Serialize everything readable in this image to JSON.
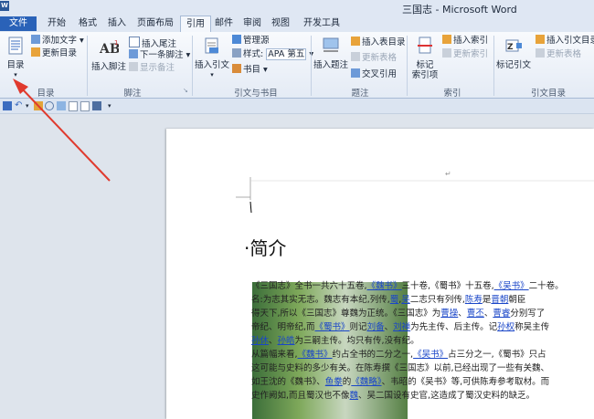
{
  "window": {
    "title": "三国志 - Microsoft Word",
    "app_letter": "W"
  },
  "tabs": [
    {
      "label": "文件",
      "name": "tab-file"
    },
    {
      "label": "开始",
      "name": "tab-home"
    },
    {
      "label": "格式",
      "name": "tab-format"
    },
    {
      "label": "插入",
      "name": "tab-insert"
    },
    {
      "label": "页面布局",
      "name": "tab-page-layout"
    },
    {
      "label": "引用",
      "name": "tab-references"
    },
    {
      "label": "邮件",
      "name": "tab-mailings"
    },
    {
      "label": "审阅",
      "name": "tab-review"
    },
    {
      "label": "视图",
      "name": "tab-view"
    },
    {
      "label": "开发工具",
      "name": "tab-developer"
    }
  ],
  "ribbon": {
    "toc": {
      "big_label": "目录",
      "add_text": "添加文字",
      "update": "更新目录",
      "group": "目录"
    },
    "footnotes": {
      "big_label": "插入脚注",
      "insert_endnote": "插入尾注",
      "next_footnote": "下一条脚注",
      "show_notes": "显示备注",
      "group": "脚注"
    },
    "citations": {
      "big_label": "插入引文",
      "manage_sources": "管理源",
      "style_label": "样式:",
      "style_value": "APA 第五",
      "bibliography": "书目",
      "group": "引文与书目"
    },
    "captions": {
      "big_label": "插入题注",
      "insert_table_of_figures": "插入表目录",
      "update_table": "更新表格",
      "cross_reference": "交叉引用",
      "group": "题注"
    },
    "index": {
      "big_label_1": "标记",
      "big_label_2": "索引项",
      "insert_index": "插入索引",
      "update_index": "更新索引",
      "group": "索引"
    },
    "authorities": {
      "big_label": "标记引文",
      "insert_toa": "插入引文目录",
      "update_table": "更新表格",
      "group": "引文目录"
    }
  },
  "document": {
    "heading": "简介",
    "lines": [
      [
        "《三国志》全书一共六十五卷,",
        {
          "link": "《魏书》"
        },
        "三十卷,《蜀书》十五卷,",
        {
          "link": "《吴书》"
        },
        "二十卷。"
      ],
      [
        "名:为志其实无志。魏志有本纪,列传,",
        {
          "link": "蜀"
        },
        ",",
        {
          "link": "吴"
        },
        "二志只有列传,",
        {
          "link": "陈寿"
        },
        "是",
        {
          "link": "晋朝"
        },
        "朝臣"
      ],
      [
        "得天下,所以《三国志》尊魏为正统。《三国志》为",
        {
          "link": "曹操"
        },
        "、",
        {
          "link": "曹丕"
        },
        "、",
        {
          "link": "曹睿"
        },
        "分别写了"
      ],
      [
        "帝纪、明帝纪,而",
        {
          "link": "《蜀书》"
        },
        "则记",
        {
          "link": "刘备"
        },
        "、",
        {
          "link": "刘禅"
        },
        "为先主传、后主传。记",
        {
          "link": "孙权"
        },
        "称吴主传"
      ],
      [
        {
          "link": "孙休"
        },
        "、",
        {
          "link": "孙皓"
        },
        "为三嗣主传。均只有传,没有纪。"
      ],
      [
        "从篇幅来看,",
        {
          "link": "《魏书》"
        },
        "约占全书的二分之一,",
        {
          "link": "《吴书》"
        },
        "占三分之一,《蜀书》只占"
      ],
      [
        "这可能与史料的多少有关。在陈寿撰《三国志》以前,已经出现了一些有关魏、"
      ],
      [
        "如王沈的《魏书》、",
        {
          "link": "鱼豢"
        },
        "的",
        {
          "link": "《魏略》"
        },
        "、韦昭的《吴书》等,可供陈寿参考取材。而"
      ],
      [
        "史作阙如,而且蜀汉也不像",
        {
          "link": "魏"
        },
        "、吴二国设有史官,这造成了蜀汉史料的缺乏。"
      ]
    ]
  },
  "colors": {
    "file_tab": "#2a62b8",
    "link": "#1a46c8",
    "arrow": "#e03a2e"
  }
}
